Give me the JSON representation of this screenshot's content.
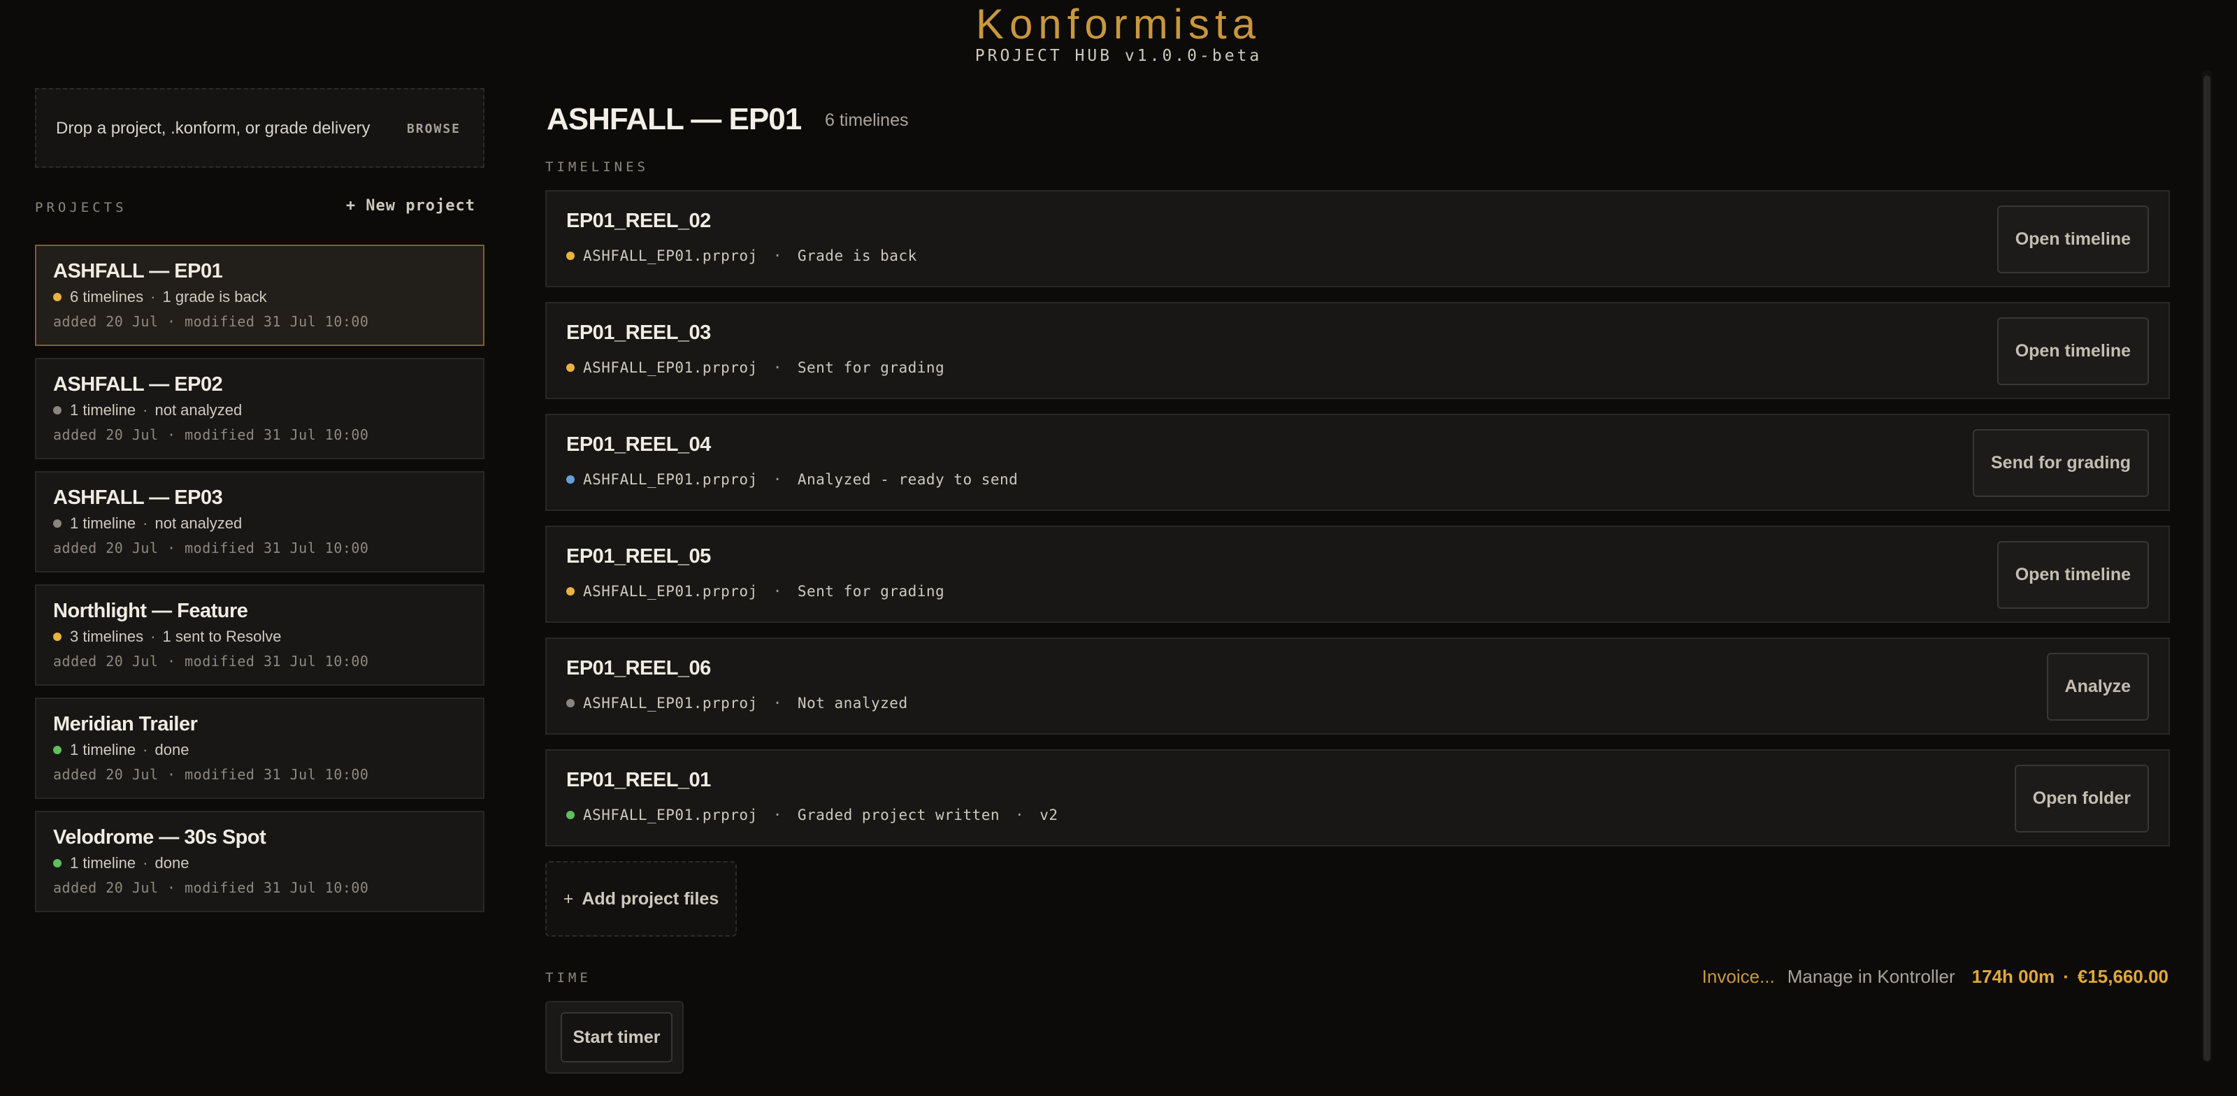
{
  "header": {
    "brand": "Konformista",
    "subtitle": "PROJECT HUB v1.0.0-beta"
  },
  "colors": {
    "accent": "#c9973e",
    "amber": "#e2a83a",
    "status_yellow": "#e8b341",
    "status_grey": "#8a857d",
    "status_green": "#5fbf5f",
    "status_blue": "#6a9fd6"
  },
  "sidebar": {
    "dropzone_text": "Drop a project, .konform, or grade delivery",
    "browse_label": "BROWSE",
    "projects_label": "PROJECTS",
    "new_project_label": "+ New project",
    "projects": [
      {
        "title": "ASHFALL — EP01",
        "count": "6 timelines",
        "status": "1 grade is back",
        "dot": "#e8b341",
        "dates": "added 20 Jul  ·  modified 31 Jul 10:00",
        "active": true
      },
      {
        "title": "ASHFALL — EP02",
        "count": "1 timeline",
        "status": "not analyzed",
        "dot": "#8a857d",
        "dates": "added 20 Jul  ·  modified 31 Jul 10:00",
        "active": false
      },
      {
        "title": "ASHFALL — EP03",
        "count": "1 timeline",
        "status": "not analyzed",
        "dot": "#8a857d",
        "dates": "added 20 Jul  ·  modified 31 Jul 10:00",
        "active": false
      },
      {
        "title": "Northlight — Feature",
        "count": "3 timelines",
        "status": "1 sent to Resolve",
        "dot": "#e8b341",
        "dates": "added 20 Jul  ·  modified 31 Jul 10:00",
        "active": false
      },
      {
        "title": "Meridian Trailer",
        "count": "1 timeline",
        "status": "done",
        "dot": "#5fbf5f",
        "dates": "added 20 Jul  ·  modified 31 Jul 10:00",
        "active": false
      },
      {
        "title": "Velodrome — 30s Spot",
        "count": "1 timeline",
        "status": "done",
        "dot": "#5fbf5f",
        "dates": "added 20 Jul  ·  modified 31 Jul 10:00",
        "active": false
      }
    ]
  },
  "main": {
    "title": "ASHFALL — EP01",
    "timeline_count": "6 timelines",
    "timelines_label": "TIMELINES",
    "timelines": [
      {
        "name": "EP01_REEL_02",
        "file": "ASHFALL_EP01.prproj",
        "status": "Grade is back",
        "extra": "",
        "dot": "#e8b341",
        "action": "Open timeline"
      },
      {
        "name": "EP01_REEL_03",
        "file": "ASHFALL_EP01.prproj",
        "status": "Sent for grading",
        "extra": "",
        "dot": "#e8b341",
        "action": "Open timeline"
      },
      {
        "name": "EP01_REEL_04",
        "file": "ASHFALL_EP01.prproj",
        "status": "Analyzed - ready to send",
        "extra": "",
        "dot": "#6a9fd6",
        "action": "Send for grading"
      },
      {
        "name": "EP01_REEL_05",
        "file": "ASHFALL_EP01.prproj",
        "status": "Sent for grading",
        "extra": "",
        "dot": "#e8b341",
        "action": "Open timeline"
      },
      {
        "name": "EP01_REEL_06",
        "file": "ASHFALL_EP01.prproj",
        "status": "Not analyzed",
        "extra": "",
        "dot": "#8a857d",
        "action": "Analyze"
      },
      {
        "name": "EP01_REEL_01",
        "file": "ASHFALL_EP01.prproj",
        "status": "Graded project written",
        "extra": "v2",
        "dot": "#5fbf5f",
        "action": "Open folder"
      }
    ],
    "add_files_label": "Add project files",
    "time_label": "TIME",
    "invoice_label": "Invoice...",
    "kontroller_label": "Manage in Kontroller",
    "hours_total": "174h 00m",
    "money_total": "€15,660.00",
    "start_timer_label": "Start timer"
  }
}
